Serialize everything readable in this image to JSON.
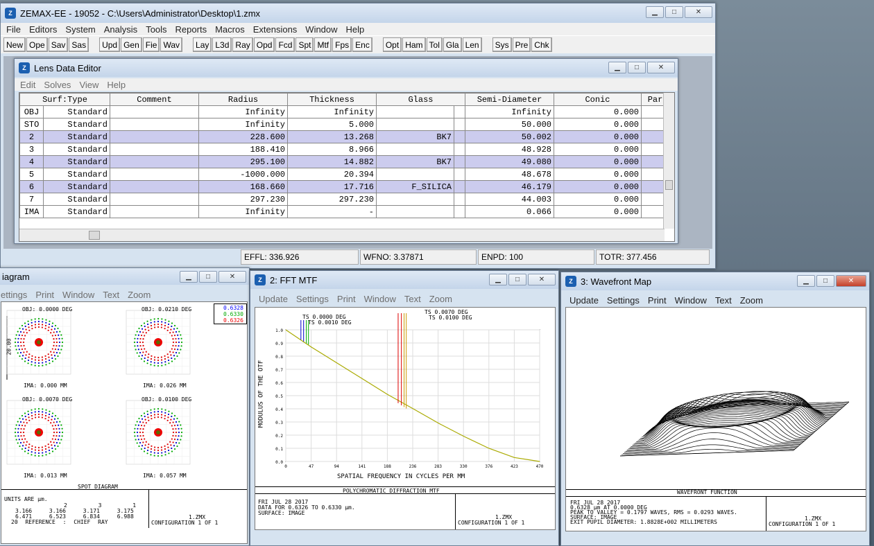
{
  "main": {
    "title": "ZEMAX-EE - 19052 - C:\\Users\\Administrator\\Desktop\\1.zmx",
    "menu": [
      "File",
      "Editors",
      "System",
      "Analysis",
      "Tools",
      "Reports",
      "Macros",
      "Extensions",
      "Window",
      "Help"
    ],
    "toolbar": [
      [
        "New",
        "Ope",
        "Sav",
        "Sas"
      ],
      [
        "Upd",
        "Gen",
        "Fie",
        "Wav"
      ],
      [
        "Lay",
        "L3d",
        "Ray",
        "Opd",
        "Fcd",
        "Spt",
        "Mtf",
        "Fps",
        "Enc"
      ],
      [
        "Opt",
        "Ham",
        "Tol",
        "Gla",
        "Len"
      ],
      [
        "Sys",
        "Pre",
        "Chk"
      ]
    ],
    "status": [
      "EFFL: 336.926",
      "WFNO: 3.37871",
      "ENPD: 100",
      "TOTR: 377.456"
    ]
  },
  "lde": {
    "title": "Lens Data Editor",
    "menu": [
      "Edit",
      "Solves",
      "View",
      "Help"
    ],
    "headers": [
      "Surf:Type",
      "Comment",
      "Radius",
      "Thickness",
      "Glass",
      "Semi-Diameter",
      "Conic",
      "Par"
    ],
    "rows": [
      [
        "OBJ",
        "Standard",
        "",
        "Infinity",
        "Infinity",
        "",
        "Infinity",
        "0.000"
      ],
      [
        "STO",
        "Standard",
        "",
        "Infinity",
        "5.000",
        "",
        "50.000",
        "0.000"
      ],
      [
        "2",
        "Standard",
        "",
        "228.600",
        "13.268",
        "BK7",
        "50.002",
        "0.000"
      ],
      [
        "3",
        "Standard",
        "",
        "188.410",
        "8.966",
        "",
        "48.928",
        "0.000"
      ],
      [
        "4",
        "Standard",
        "",
        "295.100",
        "14.882",
        "BK7",
        "49.080",
        "0.000"
      ],
      [
        "5",
        "Standard",
        "",
        "-1000.000",
        "20.394",
        "",
        "48.678",
        "0.000"
      ],
      [
        "6",
        "Standard",
        "",
        "168.660",
        "17.716",
        "F_SILICA",
        "46.179",
        "0.000"
      ],
      [
        "7",
        "Standard",
        "",
        "297.230",
        "297.230",
        "",
        "44.003",
        "0.000"
      ],
      [
        "IMA",
        "Standard",
        "",
        "Infinity",
        "-",
        "",
        "0.066",
        "0.000"
      ]
    ]
  },
  "spot": {
    "title": "iagram",
    "menu": [
      "ettings",
      "Print",
      "Window",
      "Text",
      "Zoom"
    ],
    "labels": [
      "OBJ: 0.0000 DEG",
      "OBJ: 0.0210 DEG",
      "OBJ: 0.0070 DEG",
      "OBJ: 0.0100 DEG"
    ],
    "ima": [
      "IMA: 0.000 MM",
      "IMA: 0.026 MM",
      "IMA: 0.013 MM",
      "IMA: 0.057 MM"
    ],
    "legend": [
      "0.6328",
      "0.6330",
      "0.6326"
    ],
    "caption": "SPOT DIAGRAM",
    "scale": "20.00",
    "foot": [
      "UNITS ARE µm.",
      "2 3 1",
      "3.166 3.166 3.171 3.175",
      "6.471 6.523 6.834 6.988",
      "20 REFERENCE : CHIEF RAY"
    ],
    "file": "1.ZMX",
    "config": "CONFIGURATION 1 OF 1"
  },
  "mtf": {
    "title": "2: FFT MTF",
    "menu": [
      "Update",
      "Settings",
      "Print",
      "Window",
      "Text",
      "Zoom"
    ],
    "ts1": "TS 0.0000 DEG",
    "ts2": "TS 0.0010 DEG",
    "ts3": "TS 0.0070 DEG",
    "ts4": "TS 0.0100 DEG",
    "ylabel": "MODULUS OF THE OTF",
    "xlabel": "SPATIAL FREQUENCY IN CYCLES PER MM",
    "caption": "POLYCHROMATIC DIFFRACTION MTF",
    "foot": [
      "FRI JUL 28 2017",
      "DATA FOR 0.6326 TO 0.6330 µm.",
      "SURFACE: IMAGE"
    ],
    "file": "1.ZMX",
    "config": "CONFIGURATION 1 OF 1"
  },
  "wave": {
    "title": "3: Wavefront Map",
    "menu": [
      "Update",
      "Settings",
      "Print",
      "Window",
      "Text",
      "Zoom"
    ],
    "caption": "WAVEFRONT FUNCTION",
    "foot": [
      "FRI JUL 28 2017",
      "0.6328 µm AT 0.0000 DEG",
      "PEAK TO VALLEY = 0.1797 WAVES, RMS = 0.0293 WAVES.",
      "SURFACE: IMAGE",
      "EXIT PUPIL DIAMETER: 1.8828E+002 MILLIMETERS"
    ],
    "file": "1.ZMX",
    "config": "CONFIGURATION 1 OF 1"
  },
  "chart_data": {
    "type": "line",
    "title": "POLYCHROMATIC DIFFRACTION MTF",
    "xlabel": "SPATIAL FREQUENCY IN CYCLES PER MM",
    "ylabel": "MODULUS OF THE OTF",
    "xticks": [
      "0",
      "47",
      "94",
      "141",
      "188",
      "236",
      "283",
      "330",
      "376",
      "423",
      "470"
    ],
    "yticks": [
      "0.0",
      "0.1",
      "0.2",
      "0.3",
      "0.4",
      "0.5",
      "0.6",
      "0.7",
      "0.8",
      "0.9",
      "1.0"
    ],
    "xlim": [
      0,
      470
    ],
    "ylim": [
      0,
      1
    ],
    "series": [
      {
        "x": [
          0,
          47,
          94,
          141,
          188,
          236,
          283,
          330,
          376,
          423,
          470
        ],
        "values": [
          1.0,
          0.87,
          0.75,
          0.63,
          0.51,
          0.4,
          0.29,
          0.19,
          0.1,
          0.03,
          0.0
        ]
      }
    ]
  }
}
